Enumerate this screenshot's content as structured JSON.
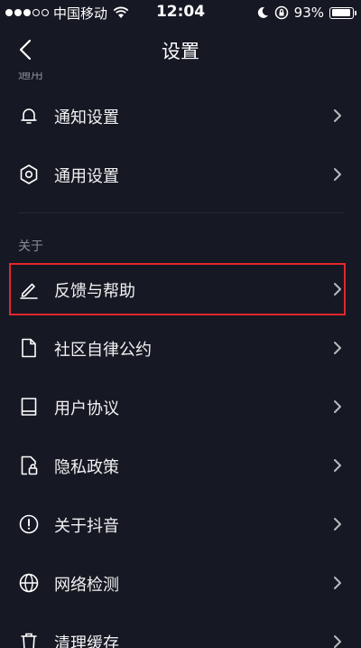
{
  "status_bar": {
    "carrier": "中国移动",
    "time": "12:04",
    "battery": "93%",
    "battery_level": 0.93
  },
  "nav": {
    "title": "设置"
  },
  "sections": {
    "general_label": "通用",
    "about_label": "关于"
  },
  "items": [
    {
      "label": "通知设置",
      "icon": "bell-icon"
    },
    {
      "label": "通用设置",
      "icon": "gear-icon"
    },
    {
      "label": "反馈与帮助",
      "icon": "pencil-icon"
    },
    {
      "label": "社区自律公约",
      "icon": "document-icon"
    },
    {
      "label": "用户协议",
      "icon": "book-icon"
    },
    {
      "label": "隐私政策",
      "icon": "privacy-lock-icon"
    },
    {
      "label": "关于抖音",
      "icon": "info-icon"
    },
    {
      "label": "网络检测",
      "icon": "globe-icon"
    },
    {
      "label": "清理缓存",
      "icon": "trash-icon"
    }
  ],
  "colors": {
    "background": "#161823",
    "highlight": "#e4262b",
    "secondary_text": "#8a8b91"
  }
}
